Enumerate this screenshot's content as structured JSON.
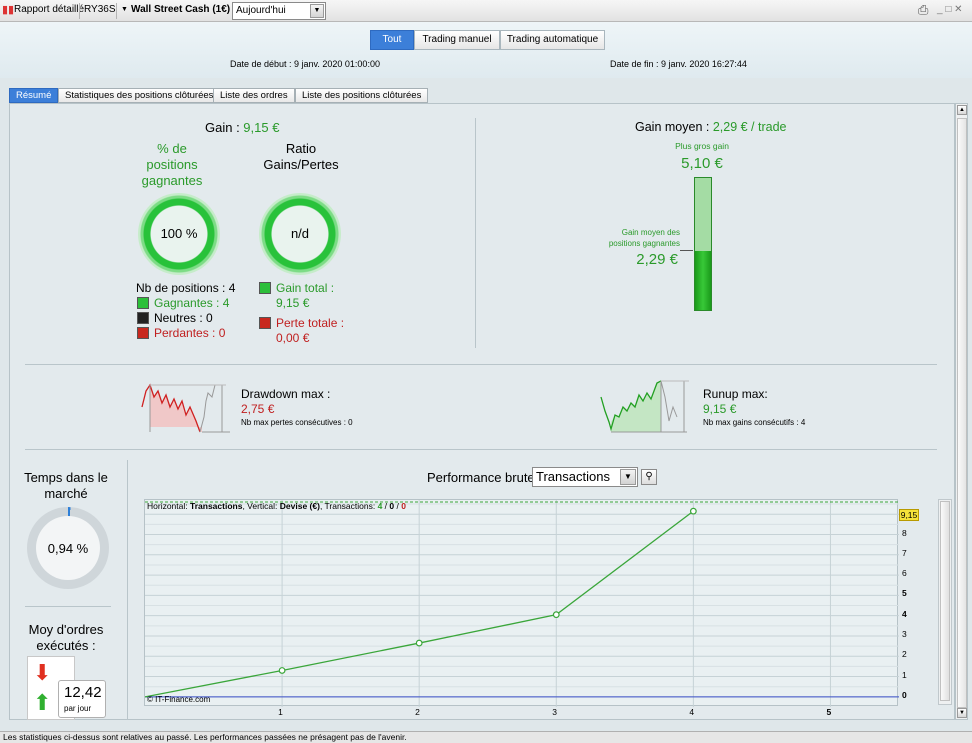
{
  "toolbar": {
    "report_label": "Rapport détaillé",
    "account": "RY36S",
    "instrument": "Wall Street Cash (1€)",
    "period": "Aujourd'hui",
    "window_controls": "_ □ ✕"
  },
  "header": {
    "segments": [
      "Tout",
      "Trading manuel",
      "Trading automatique"
    ],
    "active_segment": "Tout",
    "start_date": "Date de début : 9 janv. 2020 01:00:00",
    "end_date": "Date de fin : 9 janv. 2020 16:27:44"
  },
  "tabs": [
    "Résumé",
    "Statistiques des positions clôturées",
    "Liste des ordres",
    "Liste des positions clôturées"
  ],
  "summary": {
    "gain_label": "Gain : ",
    "gain_value": "9,15 €",
    "pct_title": "% de positions gagnantes",
    "pct_value": "100 %",
    "ratio_title": "Ratio Gains/Pertes",
    "ratio_value": "n/d",
    "nb_positions": "Nb de positions : 4",
    "gagnantes": "Gagnantes : 4",
    "neutres": "Neutres : 0",
    "perdantes": "Perdantes : 0",
    "gain_total_label": "Gain total :",
    "gain_total_value": "9,15 €",
    "perte_totale_label": "Perte totale :",
    "perte_totale_value": "0,00 €",
    "gain_moyen_label": "Gain moyen : ",
    "gain_moyen_value": "2,29 € / trade",
    "plus_gros_gain_label": "Plus gros gain",
    "plus_gros_gain_value": "5,10 €",
    "gain_moyen_pos_label": "Gain moyen des positions gagnantes",
    "gain_moyen_pos_value": "2,29 €",
    "gain_bar_fraction": 0.449,
    "drawdown_label": "Drawdown max :",
    "drawdown_value": "2,75 €",
    "drawdown_sub": "Nb max pertes consécutives : 0",
    "runup_label": "Runup max:",
    "runup_value": "9,15 €",
    "runup_sub": "Nb max gains consécutifs : 4"
  },
  "left_stats": {
    "temps_title": "Temps dans le marché",
    "temps_value": "0,94 %",
    "temps_fraction": 0.0094,
    "moy_title": "Moy d'ordres exécutés :",
    "moy_value": "12,42",
    "moy_unit": "par jour"
  },
  "performance": {
    "title": "Performance brute",
    "select_value": "Transactions",
    "info_prefix": "Horizontal: ",
    "info_h": "Transactions",
    "info_mid": ", Vertical: ",
    "info_v": "Devise (€)",
    "info_tx": ", Transactions: ",
    "info_win": "4",
    "info_slash1": " / ",
    "info_neutral": "0",
    "info_slash2": " / ",
    "info_loss": "0",
    "copyright": "© IT-Finance.com",
    "last_value_label": "9,15"
  },
  "chart_data": {
    "type": "line",
    "x": [
      0,
      1,
      2,
      3,
      4
    ],
    "series": [
      {
        "values": [
          0,
          1.3,
          2.65,
          4.05,
          9.15
        ]
      }
    ],
    "xlim": [
      0,
      5.5
    ],
    "ylim": [
      -0.5,
      9.7
    ],
    "x_ticks": [
      "1",
      "2",
      "3",
      "4",
      "5"
    ],
    "y_ticks": [
      "0",
      "1",
      "2",
      "3",
      "4",
      "5",
      "6",
      "7",
      "8"
    ],
    "grid": true,
    "colors": {
      "line": "#3aa63a",
      "zero": "#3a4fc8"
    }
  },
  "footer": "Les statistiques ci-dessus sont relatives au passé. Les performances passées ne présagent pas de l'avenir."
}
